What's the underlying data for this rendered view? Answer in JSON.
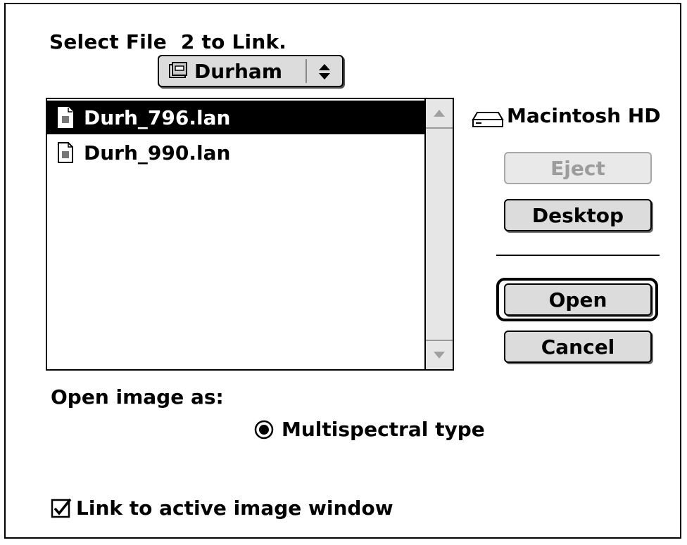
{
  "dialog": {
    "title": "Select File  2 to Link.",
    "folder_popup": {
      "label": "Durham",
      "icon": "folder-disk-icon"
    },
    "files": [
      {
        "name": "Durh_796.lan",
        "selected": true,
        "icon": "document-icon"
      },
      {
        "name": "Durh_990.lan",
        "selected": false,
        "icon": "document-icon"
      }
    ],
    "volume": {
      "label": "Macintosh HD",
      "icon": "hard-drive-icon"
    },
    "buttons": {
      "eject": "Eject",
      "desktop": "Desktop",
      "open": "Open",
      "cancel": "Cancel"
    },
    "open_as": {
      "label": "Open image as:",
      "options": [
        {
          "label": "Multispectral type",
          "selected": true
        }
      ]
    },
    "link_checkbox": {
      "label": "Link to active image window",
      "checked": true
    }
  }
}
